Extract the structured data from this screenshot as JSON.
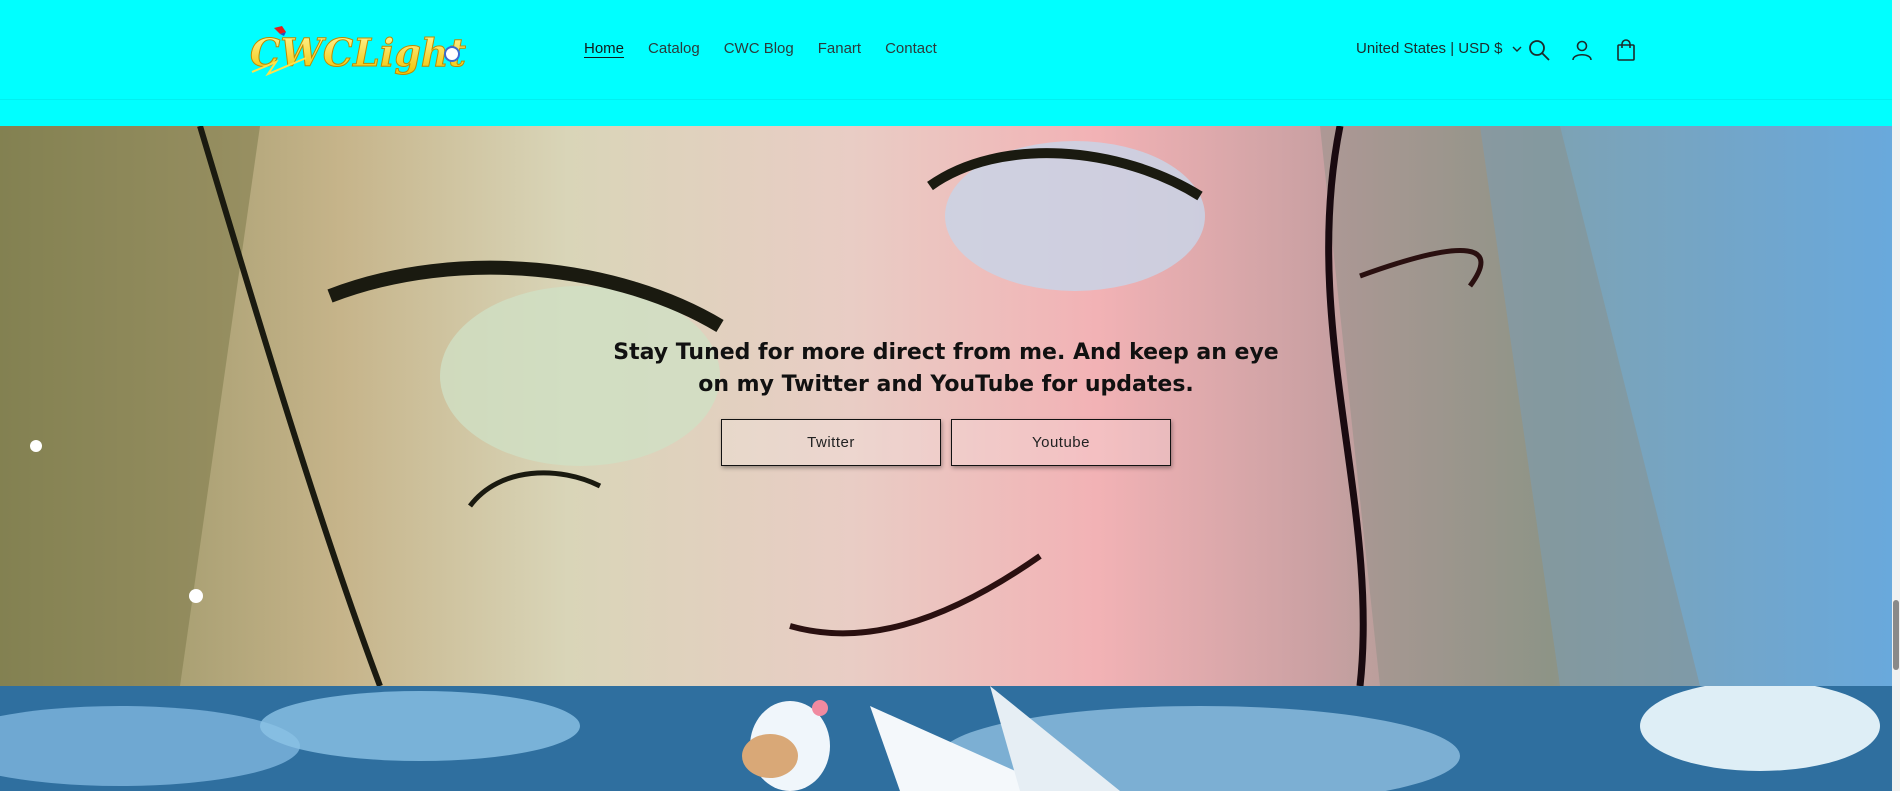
{
  "header": {
    "logo_alt": "CWCLight",
    "bg_color": "#00ffff",
    "nav": [
      {
        "label": "Home",
        "active": true
      },
      {
        "label": "Catalog",
        "active": false
      },
      {
        "label": "CWC Blog",
        "active": false
      },
      {
        "label": "Fanart",
        "active": false
      },
      {
        "label": "Contact",
        "active": false
      }
    ],
    "locale_label": "United States | USD $",
    "icons": [
      "search-icon",
      "account-icon",
      "cart-icon"
    ]
  },
  "hero": {
    "title": "Stay Tuned for more direct from me. And keep an eye on my Twitter and YouTube for updates.",
    "buttons": [
      {
        "label": "Twitter"
      },
      {
        "label": "Youtube"
      }
    ]
  }
}
